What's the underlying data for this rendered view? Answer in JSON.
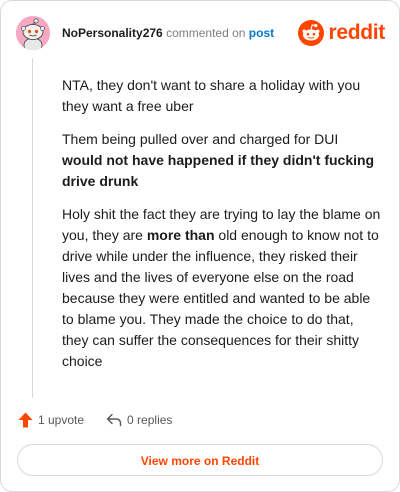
{
  "header": {
    "username": "NoPersonality276",
    "action_text": "commented on",
    "post_link_label": "post",
    "logo_text": "reddit"
  },
  "comment": {
    "paragraphs": [
      {
        "runs": [
          {
            "text": "NTA, they don't want to share a holiday with you they want a free uber"
          }
        ]
      },
      {
        "runs": [
          {
            "text": "Them being pulled over and charged for DUI "
          },
          {
            "text": "would not have happened if they didn't fucking drive drunk",
            "bold": true
          }
        ]
      },
      {
        "runs": [
          {
            "text": "Holy shit the fact they are trying to lay the blame on you, they are "
          },
          {
            "text": "more than",
            "bold": true
          },
          {
            "text": " old enough to know not to drive while under the influence, they risked their lives and the lives of everyone else on the road because they were entitled and wanted to be able to blame you. They made the choice to do that, they can suffer the consequences for their shitty choice"
          }
        ]
      }
    ]
  },
  "footer": {
    "upvote_label": "1 upvote",
    "replies_label": "0 replies",
    "view_more_label": "View more on Reddit"
  },
  "colors": {
    "brand": "#ff4500",
    "link": "#0079d3",
    "avatar_bg": "#f7a9c4",
    "border": "#d7dadc"
  },
  "icons": {
    "avatar": "snoo-avatar-icon",
    "logo": "reddit-snoo-icon",
    "upvote": "upvote-arrow-icon",
    "reply": "reply-arrow-icon"
  }
}
